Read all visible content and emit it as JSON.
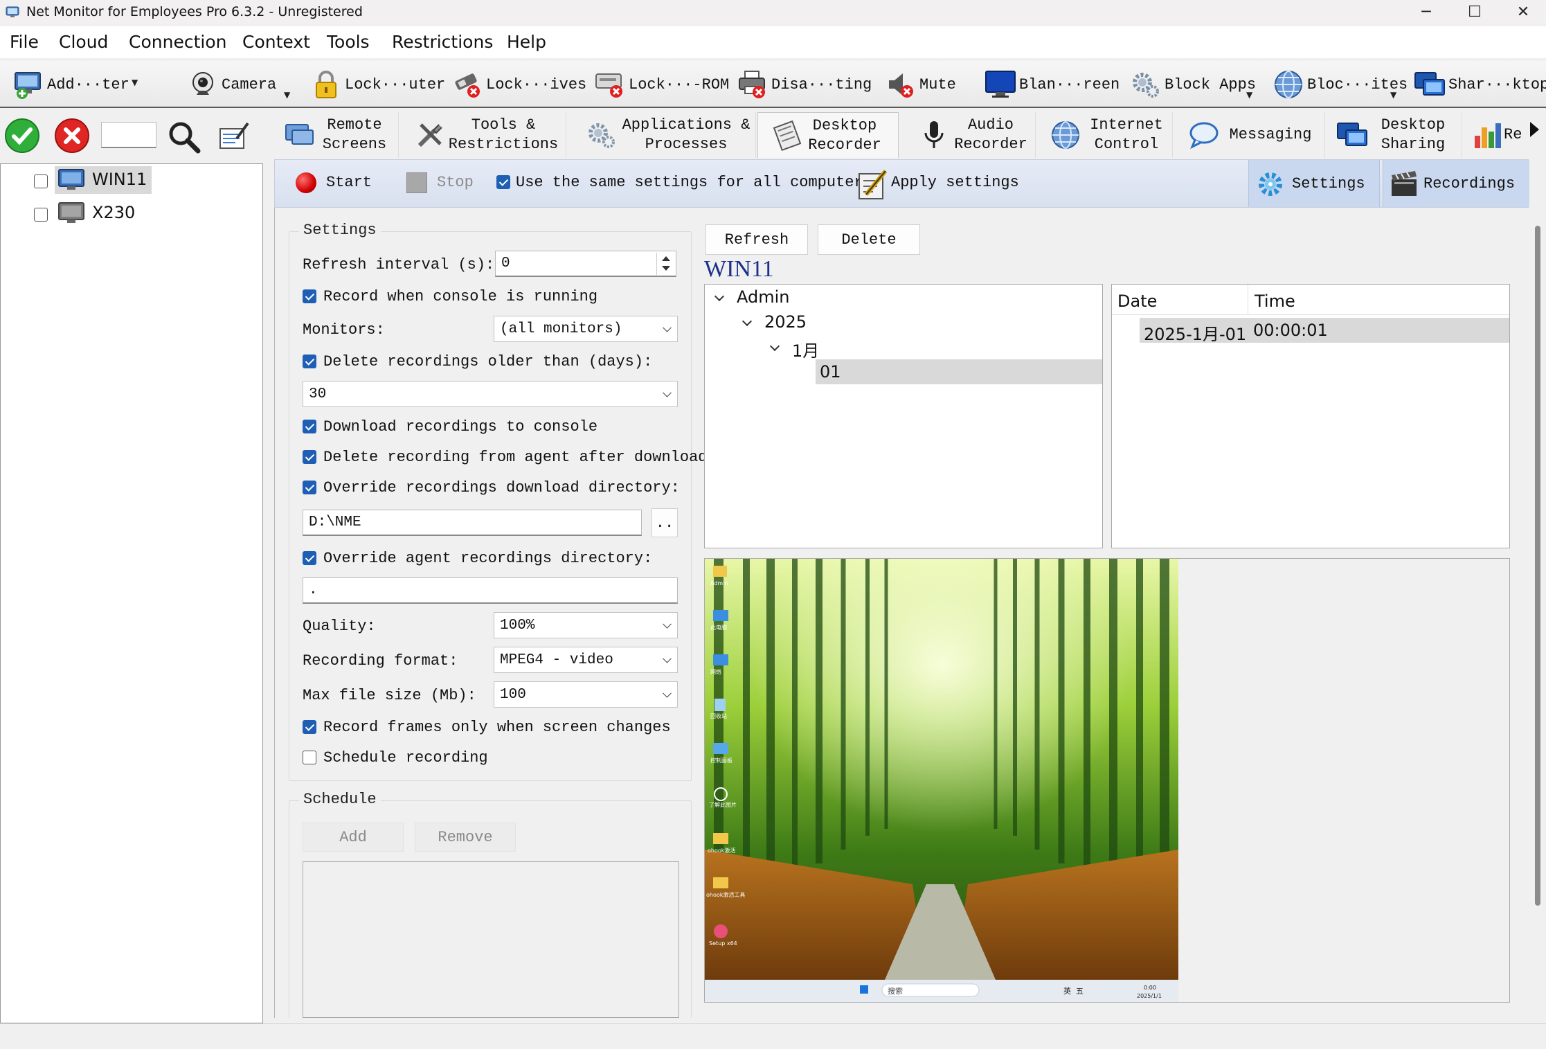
{
  "window": {
    "title": "Net Monitor for Employees Pro 6.3.2 - Unregistered",
    "minimize": "─",
    "maximize": "☐",
    "close": "✕"
  },
  "menu": [
    "File",
    "Cloud",
    "Connection",
    "Context",
    "Tools",
    "Restrictions",
    "Help"
  ],
  "toolbar": [
    {
      "label": "Add···ter",
      "icon": "add-computer-icon"
    },
    {
      "label": "Camera",
      "icon": "webcam-icon"
    },
    {
      "label": "Lock···uter",
      "icon": "padlock-icon"
    },
    {
      "label": "Lock···ives",
      "icon": "usb-drive-blocked-icon"
    },
    {
      "label": "Lock···-ROM",
      "icon": "cd-rom-blocked-icon"
    },
    {
      "label": "Disa···ting",
      "icon": "printer-blocked-icon"
    },
    {
      "label": "Mute",
      "icon": "speaker-muted-icon"
    },
    {
      "label": "Blan···reen",
      "icon": "monitor-icon"
    },
    {
      "label": "Block Apps",
      "icon": "gears-icon"
    },
    {
      "label": "Bloc···ites",
      "icon": "globe-icon"
    },
    {
      "label": "Shar···ktop",
      "icon": "desktop-share-icon"
    }
  ],
  "computers": [
    {
      "name": "WIN11",
      "checked": false,
      "selected": true
    },
    {
      "name": "X230",
      "checked": false,
      "selected": false
    }
  ],
  "tabs": [
    {
      "label": "Remote\nScreens"
    },
    {
      "label": "Tools &\nRestrictions"
    },
    {
      "label": "Applications &\nProcesses"
    },
    {
      "label": "Desktop\nRecorder"
    },
    {
      "label": "Audio\nRecorder"
    },
    {
      "label": "Internet\nControl"
    },
    {
      "label": "Messaging"
    },
    {
      "label": "Desktop\nSharing"
    },
    {
      "label": "Re"
    }
  ],
  "recorder_bar": {
    "start": "Start",
    "stop": "Stop",
    "same_settings": "Use the same settings for all computers",
    "apply": "Apply settings",
    "settings": "Settings",
    "recordings": "Recordings"
  },
  "settings": {
    "group_title": "Settings",
    "refresh_interval_label": "Refresh interval (s):",
    "refresh_interval_value": "0",
    "record_console_label": "Record when console is running",
    "monitors_label": "Monitors:",
    "monitors_value": "(all monitors)",
    "delete_older_label": "Delete recordings older than (days):",
    "delete_older_value": "30",
    "download_label": "Download recordings to console",
    "delete_agent_label": "Delete recording from agent after download",
    "override_download_label": "Override recordings download directory:",
    "download_dir_value": "D:\\NME",
    "browse_label": "..",
    "override_agent_label": "Override agent recordings directory:",
    "agent_dir_value": ".",
    "quality_label": "Quality:",
    "quality_value": "100%",
    "format_label": "Recording format:",
    "format_value": "MPEG4 - video",
    "max_size_label": "Max file size (Mb):",
    "max_size_value": "100",
    "frames_changes_label": "Record frames only when screen changes",
    "schedule_label": "Schedule recording"
  },
  "schedule": {
    "group_title": "Schedule",
    "add": "Add",
    "remove": "Remove"
  },
  "recordings": {
    "refresh": "Refresh",
    "delete": "Delete",
    "computer": "WIN11",
    "tree": {
      "user": "Admin",
      "year": "2025",
      "month": "1月",
      "day": "01"
    },
    "columns": [
      "Date",
      "Time"
    ],
    "rows": [
      {
        "date": "2025-1月-01",
        "time": "00:00:01"
      }
    ]
  },
  "preview": {
    "desktop_icons": [
      "Admin",
      "此电脑",
      "网络",
      "回收站",
      "控制面板",
      "了解此图片",
      "ohook激活",
      "ohook激活工具",
      "Setup x64"
    ],
    "taskbar_search": "搜索",
    "taskbar_ime": "英",
    "taskbar_ime2": "五",
    "clock_time": "0:00",
    "clock_date": "2025/1/1"
  }
}
